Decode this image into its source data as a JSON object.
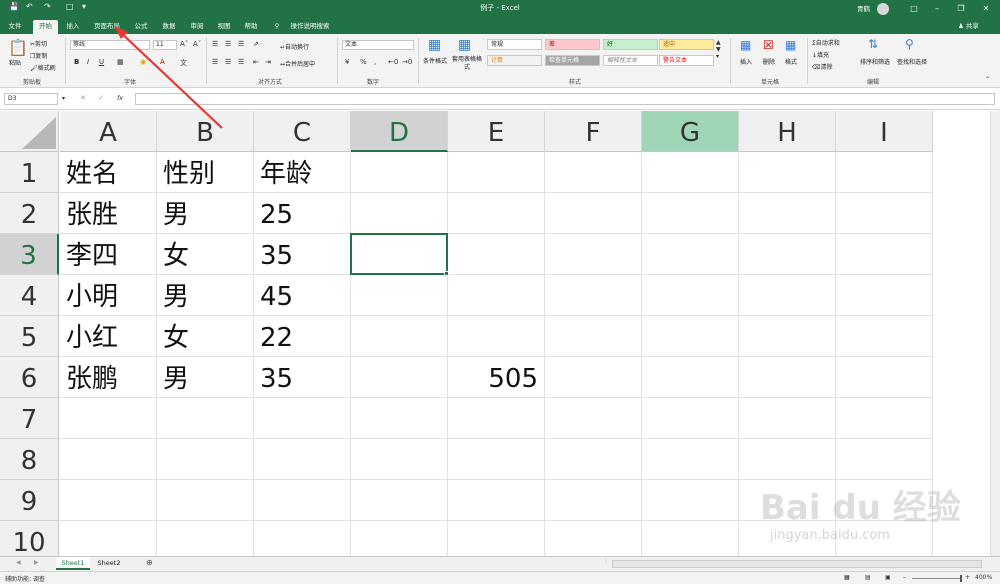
{
  "window": {
    "title": "例子 - Excel",
    "user": "青鹤"
  },
  "tabs": [
    "文件",
    "开始",
    "插入",
    "页面布局",
    "公式",
    "数据",
    "审阅",
    "视图",
    "帮助",
    "操作说明搜索"
  ],
  "share_label": "共享",
  "ribbon": {
    "clipboard": {
      "paste": "粘贴",
      "cut": "剪切",
      "copy": "复制",
      "format_painter": "格式刷",
      "group": "剪贴板"
    },
    "font": {
      "name": "等线",
      "size": "11",
      "group": "字体",
      "bold": "B",
      "italic": "I",
      "underline": "U"
    },
    "alignment": {
      "wrap": "自动换行",
      "merge": "合并后居中",
      "group": "对齐方式"
    },
    "number": {
      "format": "文本",
      "group": "数字",
      "percent": "%"
    },
    "styles": {
      "conditional": "条件格式",
      "table": "套用表格格式",
      "cells": [
        {
          "label": "常规",
          "bg": "#ffffff",
          "fg": "#222222"
        },
        {
          "label": "差",
          "bg": "#ffc7ce",
          "fg": "#9c0006"
        },
        {
          "label": "好",
          "bg": "#c6efce",
          "fg": "#006100"
        },
        {
          "label": "适中",
          "bg": "#ffeb9c",
          "fg": "#9c5700"
        },
        {
          "label": "计算",
          "bg": "#f2f2f2",
          "fg": "#fa7d00"
        },
        {
          "label": "检查单元格",
          "bg": "#a5a5a5",
          "fg": "#ffffff"
        },
        {
          "label": "解释性文本",
          "bg": "#ffffff",
          "fg": "#7f7f7f"
        },
        {
          "label": "警告文本",
          "bg": "#ffffff",
          "fg": "#ff0000"
        }
      ],
      "group": "样式"
    },
    "cells_group": {
      "insert": "插入",
      "delete": "删除",
      "format": "格式",
      "group": "单元格"
    },
    "editing": {
      "autosum": "自动求和",
      "fill": "填充",
      "clear": "清除",
      "sort": "排序和筛选",
      "find": "查找和选择",
      "group": "编辑"
    }
  },
  "formula_bar": {
    "name_box": "D3",
    "fx": "fx",
    "content": ""
  },
  "grid": {
    "columns": [
      "A",
      "B",
      "C",
      "D",
      "E",
      "F",
      "G",
      "H",
      "I"
    ],
    "rows": [
      "1",
      "2",
      "3",
      "4",
      "5",
      "6",
      "7",
      "8",
      "9",
      "10"
    ],
    "cells": {
      "A1": "姓名",
      "B1": "性别",
      "C1": "年龄",
      "A2": "张胜",
      "B2": "男",
      "C2": "25",
      "A3": "李四",
      "B3": "女",
      "C3": "35",
      "A4": "小明",
      "B4": "男",
      "C4": "45",
      "A5": "小红",
      "B5": "女",
      "C5": "22",
      "A6": "张鹏",
      "B6": "男",
      "C6": "35",
      "E6": "505"
    },
    "selected_cell": "D3",
    "highlighted_column": "G"
  },
  "sheets": [
    "Sheet1",
    "Sheet2"
  ],
  "active_sheet": "Sheet1",
  "status": {
    "accessibility": "辅助功能: 调查",
    "zoom": "400%"
  },
  "watermark": {
    "brand": "Bai du 经验",
    "url": "jingyan.baidu.com"
  },
  "colors": {
    "excel_green": "#217346",
    "arrow_red": "#e53935"
  }
}
